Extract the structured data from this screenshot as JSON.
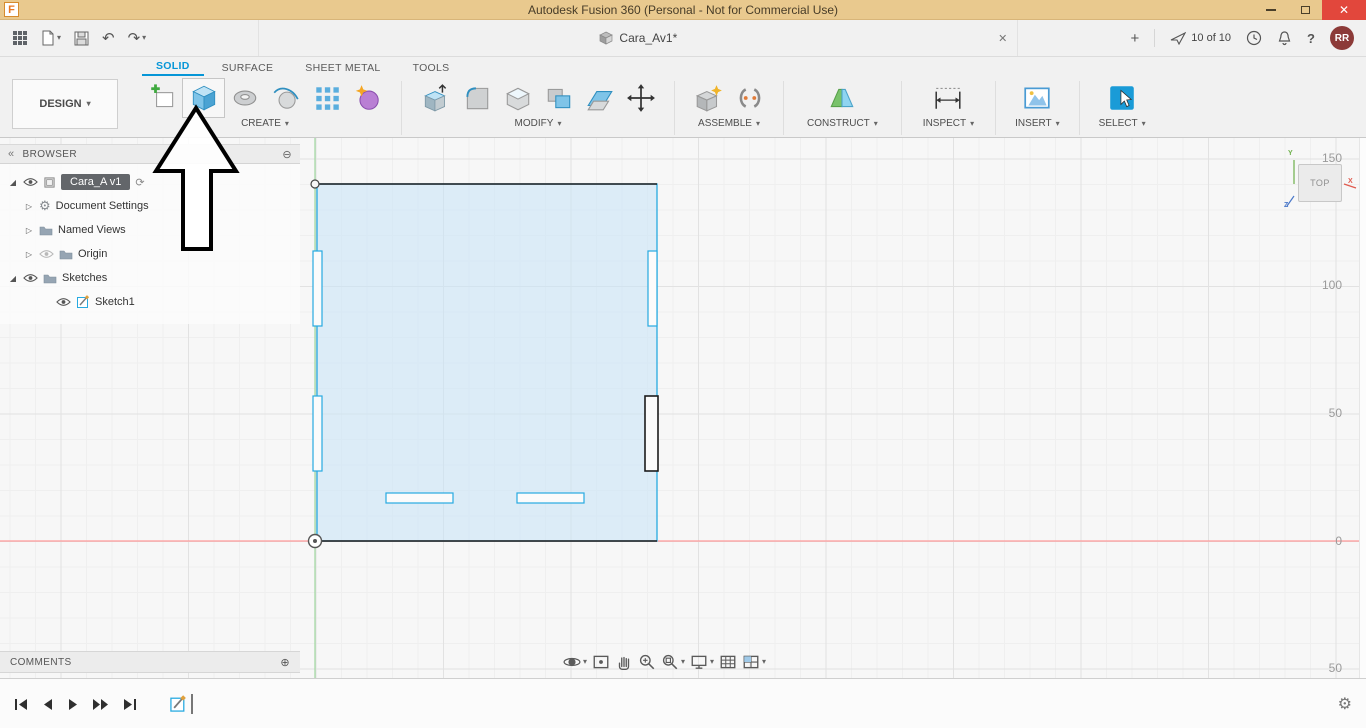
{
  "titlebar": {
    "app_initial": "F",
    "title": "Autodesk Fusion 360 (Personal - Not for Commercial Use)"
  },
  "icons": {
    "caret": "▾",
    "chevron_left": "«",
    "undo": "↶",
    "redo": "↷",
    "plus": "+",
    "close": "✕",
    "collapse_circle": "⊖",
    "expand_circle": "⊕",
    "tree_collapsed": "▷",
    "tree_expanded": "◢",
    "gear": "⚙",
    "help": "?",
    "sync": "⟳"
  },
  "doc_bar": {
    "tab_label": "Cara_Av1*",
    "job_status": "10 of 10",
    "avatar": "RR"
  },
  "ribbon": {
    "design_label": "DESIGN",
    "tabs": [
      {
        "label": "SOLID"
      },
      {
        "label": "SURFACE"
      },
      {
        "label": "SHEET METAL"
      },
      {
        "label": "TOOLS"
      }
    ],
    "groups": [
      {
        "label": "CREATE"
      },
      {
        "label": "MODIFY"
      },
      {
        "label": "ASSEMBLE"
      },
      {
        "label": "CONSTRUCT"
      },
      {
        "label": "INSPECT"
      },
      {
        "label": "INSERT"
      },
      {
        "label": "SELECT"
      }
    ]
  },
  "browser": {
    "header": "BROWSER",
    "items": [
      {
        "label": "Cara_A v1"
      },
      {
        "label": "Document Settings"
      },
      {
        "label": "Named Views"
      },
      {
        "label": "Origin"
      },
      {
        "label": "Sketches"
      },
      {
        "label": "Sketch1"
      }
    ]
  },
  "canvas": {
    "viewcube": "TOP",
    "axis": {
      "x": "X",
      "y": "Y",
      "z": "Z"
    },
    "ruler_labels": [
      "150",
      "100",
      "50",
      "0",
      "50"
    ]
  },
  "comments": {
    "header": "COMMENTS"
  }
}
